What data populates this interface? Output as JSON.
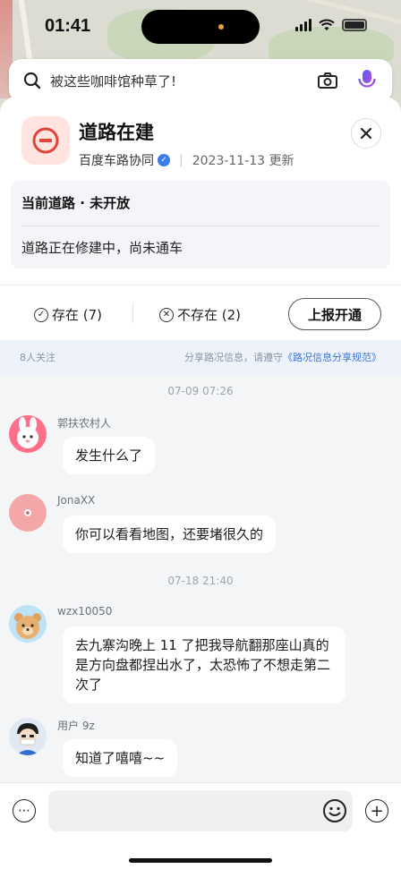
{
  "status_bar": {
    "time": "01:41"
  },
  "search": {
    "placeholder": "被这些咖啡馆种草了!"
  },
  "card": {
    "title": "道路在建",
    "source": "百度车路协同",
    "date": "2023-11-13 更新",
    "info_heading": "当前道路 · 未开放",
    "info_body": "道路正在修建中，尚未通车",
    "exists_label": "存在 (7)",
    "not_exists_label": "不存在 (2)",
    "report_label": "上报开通"
  },
  "follow_bar": {
    "followers": "8人关注",
    "notice_prefix": "分享路况信息，请遵守",
    "notice_link": "《路况信息分享规范》"
  },
  "chat": {
    "timestamps": [
      "07-09 07:26",
      "07-18 21:40"
    ],
    "messages": [
      {
        "user": "郭扶农村人",
        "text": "发生什么了"
      },
      {
        "user": "JonaXX",
        "text": "你可以看看地图，还要堵很久的"
      },
      {
        "user": "wzx10050",
        "text": "去九寨沟晚上 11 了把我导航翻那座山真的是方向盘都捏出水了，太恐怖了不想走第二次了"
      },
      {
        "user": "用户 9z",
        "text": "知道了嘻嘻~~"
      }
    ]
  },
  "colors": {
    "accent_blue": "#3b73d9",
    "warning_red": "#e0443a",
    "badge_bg": "#ffe4e0"
  }
}
